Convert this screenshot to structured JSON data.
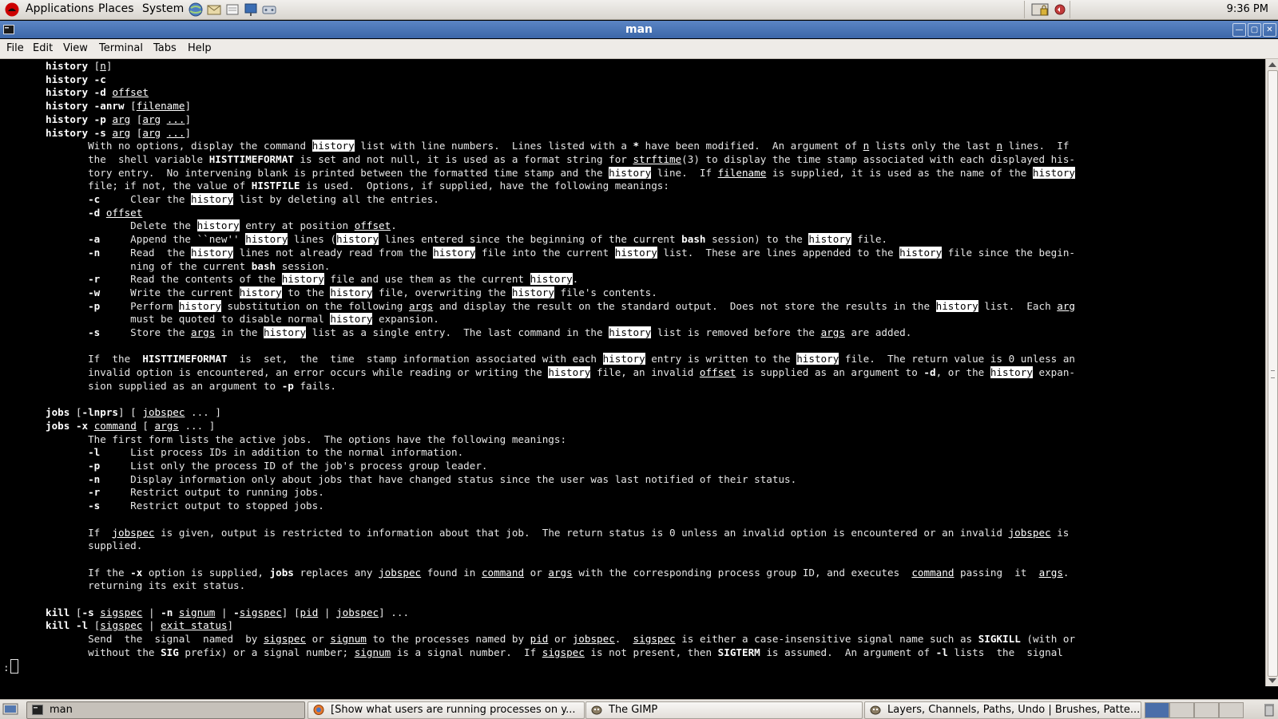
{
  "top_panel": {
    "menus": [
      "Applications",
      "Places",
      "System"
    ],
    "launchers": [
      "globe-icon",
      "mail-icon",
      "notes-icon",
      "presentation-icon",
      "network-icon"
    ],
    "tray_icons": [
      "lock-icon",
      "volume-icon"
    ],
    "clock": "9:36 PM"
  },
  "window": {
    "title": "man"
  },
  "menubar": [
    "File",
    "Edit",
    "View",
    "Terminal",
    "Tabs",
    "Help"
  ],
  "terminal": {
    "lines": [
      [
        [
          "b",
          "history"
        ],
        [
          "",
          " ["
        ],
        [
          "u",
          "n"
        ],
        [
          "",
          "]"
        ]
      ],
      [
        [
          "b",
          "history"
        ],
        [
          "",
          " "
        ],
        [
          "b",
          "-c"
        ]
      ],
      [
        [
          "b",
          "history"
        ],
        [
          "",
          " "
        ],
        [
          "b",
          "-d"
        ],
        [
          "",
          " "
        ],
        [
          "u",
          "offset"
        ]
      ],
      [
        [
          "b",
          "history"
        ],
        [
          "",
          " "
        ],
        [
          "b",
          "-anrw"
        ],
        [
          "",
          " ["
        ],
        [
          "u",
          "filename"
        ],
        [
          "",
          "]"
        ]
      ],
      [
        [
          "b",
          "history"
        ],
        [
          "",
          " "
        ],
        [
          "b",
          "-p"
        ],
        [
          "",
          " "
        ],
        [
          "u",
          "arg"
        ],
        [
          "",
          " ["
        ],
        [
          "u",
          "arg"
        ],
        [
          "",
          " "
        ],
        [
          "u",
          "..."
        ],
        [
          "",
          "]"
        ]
      ],
      [
        [
          "b",
          "history"
        ],
        [
          "",
          " "
        ],
        [
          "b",
          "-s"
        ],
        [
          "",
          " "
        ],
        [
          "u",
          "arg"
        ],
        [
          "",
          " ["
        ],
        [
          "u",
          "arg"
        ],
        [
          "",
          " "
        ],
        [
          "u",
          "..."
        ],
        [
          "",
          "]"
        ]
      ],
      [
        [
          "",
          "       With no options, display the command "
        ],
        [
          "h",
          "history"
        ],
        [
          "",
          " list with line numbers.  Lines listed with a "
        ],
        [
          "b",
          "*"
        ],
        [
          "",
          " have been modified.  An argument of "
        ],
        [
          "u",
          "n"
        ],
        [
          "",
          " lists only the last "
        ],
        [
          "u",
          "n"
        ],
        [
          "",
          " lines.  If"
        ]
      ],
      [
        [
          "",
          "       the  shell variable "
        ],
        [
          "b",
          "HISTTIMEFORMAT"
        ],
        [
          "",
          " is set and not null, it is used as a format string for "
        ],
        [
          "u",
          "strftime"
        ],
        [
          "",
          "(3) to display the time stamp associated with each displayed his-"
        ]
      ],
      [
        [
          "",
          "       tory entry.  No intervening blank is printed between the formatted time stamp and the "
        ],
        [
          "h",
          "history"
        ],
        [
          "",
          " line.  If "
        ],
        [
          "u",
          "filename"
        ],
        [
          "",
          " is supplied, it is used as the name of the "
        ],
        [
          "h",
          "history"
        ]
      ],
      [
        [
          "",
          "       file; if not, the value of "
        ],
        [
          "b",
          "HISTFILE"
        ],
        [
          "",
          " is used.  Options, if supplied, have the following meanings:"
        ]
      ],
      [
        [
          "",
          "       "
        ],
        [
          "b",
          "-c"
        ],
        [
          "",
          "     Clear the "
        ],
        [
          "h",
          "history"
        ],
        [
          "",
          " list by deleting all the entries."
        ]
      ],
      [
        [
          "",
          "       "
        ],
        [
          "b",
          "-d"
        ],
        [
          "",
          " "
        ],
        [
          "u",
          "offset"
        ]
      ],
      [
        [
          "",
          "              Delete the "
        ],
        [
          "h",
          "history"
        ],
        [
          "",
          " entry at position "
        ],
        [
          "u",
          "offset"
        ],
        [
          "",
          "."
        ]
      ],
      [
        [
          "",
          "       "
        ],
        [
          "b",
          "-a"
        ],
        [
          "",
          "     Append the ``new'' "
        ],
        [
          "h",
          "history"
        ],
        [
          "",
          " lines ("
        ],
        [
          "h",
          "history"
        ],
        [
          "",
          " lines entered since the beginning of the current "
        ],
        [
          "b",
          "bash"
        ],
        [
          "",
          " session) to the "
        ],
        [
          "h",
          "history"
        ],
        [
          "",
          " file."
        ]
      ],
      [
        [
          "",
          "       "
        ],
        [
          "b",
          "-n"
        ],
        [
          "",
          "     Read  the "
        ],
        [
          "h",
          "history"
        ],
        [
          "",
          " lines not already read from the "
        ],
        [
          "h",
          "history"
        ],
        [
          "",
          " file into the current "
        ],
        [
          "h",
          "history"
        ],
        [
          "",
          " list.  These are lines appended to the "
        ],
        [
          "h",
          "history"
        ],
        [
          "",
          " file since the begin-"
        ]
      ],
      [
        [
          "",
          "              ning of the current "
        ],
        [
          "b",
          "bash"
        ],
        [
          "",
          " session."
        ]
      ],
      [
        [
          "",
          "       "
        ],
        [
          "b",
          "-r"
        ],
        [
          "",
          "     Read the contents of the "
        ],
        [
          "h",
          "history"
        ],
        [
          "",
          " file and use them as the current "
        ],
        [
          "h",
          "history"
        ],
        [
          "",
          "."
        ]
      ],
      [
        [
          "",
          "       "
        ],
        [
          "b",
          "-w"
        ],
        [
          "",
          "     Write the current "
        ],
        [
          "h",
          "history"
        ],
        [
          "",
          " to the "
        ],
        [
          "h",
          "history"
        ],
        [
          "",
          " file, overwriting the "
        ],
        [
          "h",
          "history"
        ],
        [
          "",
          " file's contents."
        ]
      ],
      [
        [
          "",
          "       "
        ],
        [
          "b",
          "-p"
        ],
        [
          "",
          "     Perform "
        ],
        [
          "h",
          "history"
        ],
        [
          "",
          " substitution on the following "
        ],
        [
          "u",
          "args"
        ],
        [
          "",
          " and display the result on the standard output.  Does not store the results in the "
        ],
        [
          "h",
          "history"
        ],
        [
          "",
          " list.  Each "
        ],
        [
          "u",
          "arg"
        ]
      ],
      [
        [
          "",
          "              must be quoted to disable normal "
        ],
        [
          "h",
          "history"
        ],
        [
          "",
          " expansion."
        ]
      ],
      [
        [
          "",
          "       "
        ],
        [
          "b",
          "-s"
        ],
        [
          "",
          "     Store the "
        ],
        [
          "u",
          "args"
        ],
        [
          "",
          " in the "
        ],
        [
          "h",
          "history"
        ],
        [
          "",
          " list as a single entry.  The last command in the "
        ],
        [
          "h",
          "history"
        ],
        [
          "",
          " list is removed before the "
        ],
        [
          "u",
          "args"
        ],
        [
          "",
          " are added."
        ]
      ],
      [],
      [
        [
          "",
          "       If  the  "
        ],
        [
          "b",
          "HISTTIMEFORMAT"
        ],
        [
          "",
          "  is  set,  the  time  stamp information associated with each "
        ],
        [
          "h",
          "history"
        ],
        [
          "",
          " entry is written to the "
        ],
        [
          "h",
          "history"
        ],
        [
          "",
          " file.  The return value is 0 unless an"
        ]
      ],
      [
        [
          "",
          "       invalid option is encountered, an error occurs while reading or writing the "
        ],
        [
          "h",
          "history"
        ],
        [
          "",
          " file, an invalid "
        ],
        [
          "u",
          "offset"
        ],
        [
          "",
          " is supplied as an argument to "
        ],
        [
          "b",
          "-d"
        ],
        [
          "",
          ", or the "
        ],
        [
          "h",
          "history"
        ],
        [
          "",
          " expan-"
        ]
      ],
      [
        [
          "",
          "       sion supplied as an argument to "
        ],
        [
          "b",
          "-p"
        ],
        [
          "",
          " fails."
        ]
      ],
      [],
      [
        [
          "b",
          "jobs"
        ],
        [
          "",
          " ["
        ],
        [
          "b",
          "-lnprs"
        ],
        [
          "",
          "] [ "
        ],
        [
          "u",
          "jobspec"
        ],
        [
          "",
          " ... ]"
        ]
      ],
      [
        [
          "b",
          "jobs"
        ],
        [
          "",
          " "
        ],
        [
          "b",
          "-x"
        ],
        [
          "",
          " "
        ],
        [
          "u",
          "command"
        ],
        [
          "",
          " [ "
        ],
        [
          "u",
          "args"
        ],
        [
          "",
          " ... ]"
        ]
      ],
      [
        [
          "",
          "       The first form lists the active jobs.  The options have the following meanings:"
        ]
      ],
      [
        [
          "",
          "       "
        ],
        [
          "b",
          "-l"
        ],
        [
          "",
          "     List process IDs in addition to the normal information."
        ]
      ],
      [
        [
          "",
          "       "
        ],
        [
          "b",
          "-p"
        ],
        [
          "",
          "     List only the process ID of the job's process group leader."
        ]
      ],
      [
        [
          "",
          "       "
        ],
        [
          "b",
          "-n"
        ],
        [
          "",
          "     Display information only about jobs that have changed status since the user was last notified of their status."
        ]
      ],
      [
        [
          "",
          "       "
        ],
        [
          "b",
          "-r"
        ],
        [
          "",
          "     Restrict output to running jobs."
        ]
      ],
      [
        [
          "",
          "       "
        ],
        [
          "b",
          "-s"
        ],
        [
          "",
          "     Restrict output to stopped jobs."
        ]
      ],
      [],
      [
        [
          "",
          "       If  "
        ],
        [
          "u",
          "jobspec"
        ],
        [
          "",
          " is given, output is restricted to information about that job.  The return status is 0 unless an invalid option is encountered or an invalid "
        ],
        [
          "u",
          "jobspec"
        ],
        [
          "",
          " is"
        ]
      ],
      [
        [
          "",
          "       supplied."
        ]
      ],
      [],
      [
        [
          "",
          "       If the "
        ],
        [
          "b",
          "-x"
        ],
        [
          "",
          " option is supplied, "
        ],
        [
          "b",
          "jobs"
        ],
        [
          "",
          " replaces any "
        ],
        [
          "u",
          "jobspec"
        ],
        [
          "",
          " found in "
        ],
        [
          "u",
          "command"
        ],
        [
          "",
          " or "
        ],
        [
          "u",
          "args"
        ],
        [
          "",
          " with the corresponding process group ID, and executes  "
        ],
        [
          "u",
          "command"
        ],
        [
          "",
          " passing  it  "
        ],
        [
          "u",
          "args"
        ],
        [
          "",
          "."
        ]
      ],
      [
        [
          "",
          "       returning its exit status."
        ]
      ],
      [],
      [
        [
          "b",
          "kill"
        ],
        [
          "",
          " ["
        ],
        [
          "b",
          "-s"
        ],
        [
          "",
          " "
        ],
        [
          "u",
          "sigspec"
        ],
        [
          "",
          " | "
        ],
        [
          "b",
          "-n"
        ],
        [
          "",
          " "
        ],
        [
          "u",
          "signum"
        ],
        [
          "",
          " | "
        ],
        [
          "b",
          "-"
        ],
        [
          "u",
          "sigspec"
        ],
        [
          "",
          "] ["
        ],
        [
          "u",
          "pid"
        ],
        [
          "",
          " | "
        ],
        [
          "u",
          "jobspec"
        ],
        [
          "",
          "] ..."
        ]
      ],
      [
        [
          "b",
          "kill"
        ],
        [
          "",
          " "
        ],
        [
          "b",
          "-l"
        ],
        [
          "",
          " ["
        ],
        [
          "u",
          "sigspec"
        ],
        [
          "",
          " | "
        ],
        [
          "u",
          "exit status"
        ],
        [
          "",
          "]"
        ]
      ],
      [
        [
          "",
          "       Send  the  signal  named  by "
        ],
        [
          "u",
          "sigspec"
        ],
        [
          "",
          " or "
        ],
        [
          "u",
          "signum"
        ],
        [
          "",
          " to the processes named by "
        ],
        [
          "u",
          "pid"
        ],
        [
          "",
          " or "
        ],
        [
          "u",
          "jobspec"
        ],
        [
          "",
          ".  "
        ],
        [
          "u",
          "sigspec"
        ],
        [
          "",
          " is either a case-insensitive signal name such as "
        ],
        [
          "b",
          "SIGKILL"
        ],
        [
          "",
          " (with or"
        ]
      ],
      [
        [
          "",
          "       without the "
        ],
        [
          "b",
          "SIG"
        ],
        [
          "",
          " prefix) or a signal number; "
        ],
        [
          "u",
          "signum"
        ],
        [
          "",
          " is a signal number.  If "
        ],
        [
          "u",
          "sigspec"
        ],
        [
          "",
          " is not present, then "
        ],
        [
          "b",
          "SIGTERM"
        ],
        [
          "",
          " is assumed.  An argument of "
        ],
        [
          "b",
          "-l"
        ],
        [
          "",
          " lists  the  signal"
        ]
      ],
      [
        [
          "",
          ":"
        ]
      ]
    ]
  },
  "taskbar": {
    "items": [
      {
        "label": "man",
        "icon": "terminal-icon",
        "active": true
      },
      {
        "label": "[Show what users are running processes on y...",
        "icon": "firefox-icon",
        "active": false
      },
      {
        "label": "The GIMP",
        "icon": "gimp-icon",
        "active": false
      },
      {
        "label": "Layers, Channels, Paths, Undo | Brushes, Patte...",
        "icon": "gimp-icon",
        "active": false
      }
    ]
  }
}
